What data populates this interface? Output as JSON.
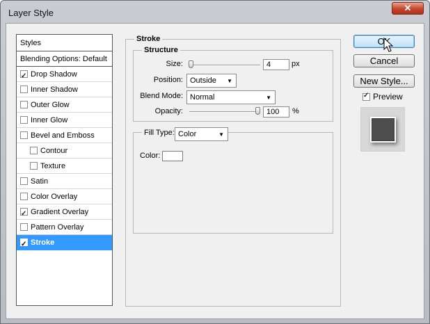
{
  "window": {
    "title": "Layer Style",
    "close_glyph": "✕"
  },
  "styles_panel": {
    "header": "Styles",
    "blending_options": "Blending Options: Default",
    "items": [
      {
        "label": "Drop Shadow",
        "checked": true,
        "indent": false,
        "selected": false
      },
      {
        "label": "Inner Shadow",
        "checked": false,
        "indent": false,
        "selected": false
      },
      {
        "label": "Outer Glow",
        "checked": false,
        "indent": false,
        "selected": false
      },
      {
        "label": "Inner Glow",
        "checked": false,
        "indent": false,
        "selected": false
      },
      {
        "label": "Bevel and Emboss",
        "checked": false,
        "indent": false,
        "selected": false
      },
      {
        "label": "Contour",
        "checked": false,
        "indent": true,
        "selected": false
      },
      {
        "label": "Texture",
        "checked": false,
        "indent": true,
        "selected": false
      },
      {
        "label": "Satin",
        "checked": false,
        "indent": false,
        "selected": false
      },
      {
        "label": "Color Overlay",
        "checked": false,
        "indent": false,
        "selected": false
      },
      {
        "label": "Gradient Overlay",
        "checked": true,
        "indent": false,
        "selected": false
      },
      {
        "label": "Pattern Overlay",
        "checked": false,
        "indent": false,
        "selected": false
      },
      {
        "label": "Stroke",
        "checked": true,
        "indent": false,
        "selected": true
      }
    ]
  },
  "stroke": {
    "title": "Stroke",
    "structure": {
      "title": "Structure",
      "size_label": "Size:",
      "size_value": "4",
      "size_unit": "px",
      "position_label": "Position:",
      "position_value": "Outside",
      "blend_mode_label": "Blend Mode:",
      "blend_mode_value": "Normal",
      "opacity_label": "Opacity:",
      "opacity_value": "100",
      "opacity_unit": "%"
    },
    "fill": {
      "fill_type_label": "Fill Type:",
      "fill_type_value": "Color",
      "color_label": "Color:",
      "color_value": "#ffffff"
    }
  },
  "buttons": {
    "ok": "OK",
    "cancel": "Cancel",
    "new_style": "New Style..."
  },
  "preview": {
    "label": "Preview",
    "checked": true
  },
  "colors": {
    "selection": "#3399ff",
    "close": "#c4442b"
  },
  "icons": {
    "dropdown": "chevron-down-icon",
    "cursor": "mouse-pointer-icon"
  }
}
